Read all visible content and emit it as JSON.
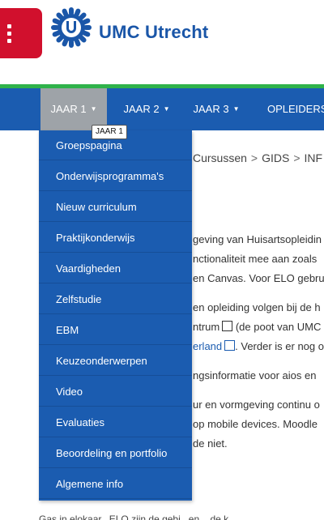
{
  "header": {
    "brand": "UMC Utrecht",
    "logo_icon": "umc-logo-icon",
    "menu_icon": "hamburger-menu-icon",
    "colors": {
      "menu_bg": "#d1102d",
      "brand": "#1a56a8",
      "accent_line": "#2fb24a"
    }
  },
  "navbar": {
    "bg": "#1b5cb0",
    "items": [
      {
        "label": "JAAR 1"
      },
      {
        "label": "JAAR 2"
      },
      {
        "label": "JAAR 3"
      },
      {
        "label": "OPLEIDERS"
      }
    ],
    "tooltip": "JAAR 1"
  },
  "dropdown": {
    "items": [
      "Groepspagina",
      "Onderwijsprogramma's",
      "Nieuw curriculum",
      "Praktijkonderwijs",
      "Vaardigheden",
      "Zelfstudie",
      "EBM",
      "Keuzeonderwerpen",
      "Video",
      "Evaluaties",
      "Beoordeling en portfolio",
      "Algemene info"
    ]
  },
  "content": {
    "breadcrumb": [
      "Cursussen",
      "GIDS",
      "INF"
    ],
    "lines": [
      "geving van Huisartsopleidin",
      "nctionaliteit mee aan zoals",
      "en Canvas. Voor ELO gebrui",
      "en opleiding volgen bij de h",
      "ntrum",
      " (de poot van UMC",
      "erland",
      ". Verder is er nog o",
      "ngsinformatie voor aios en",
      "ur en vormgeving continu o",
      "op mobile devices. Moodle",
      "de niet."
    ],
    "bottom_text": "Ga",
    "bottom_text_rest": "s in elokaar...ELO zijn de gebi...en... de k"
  }
}
